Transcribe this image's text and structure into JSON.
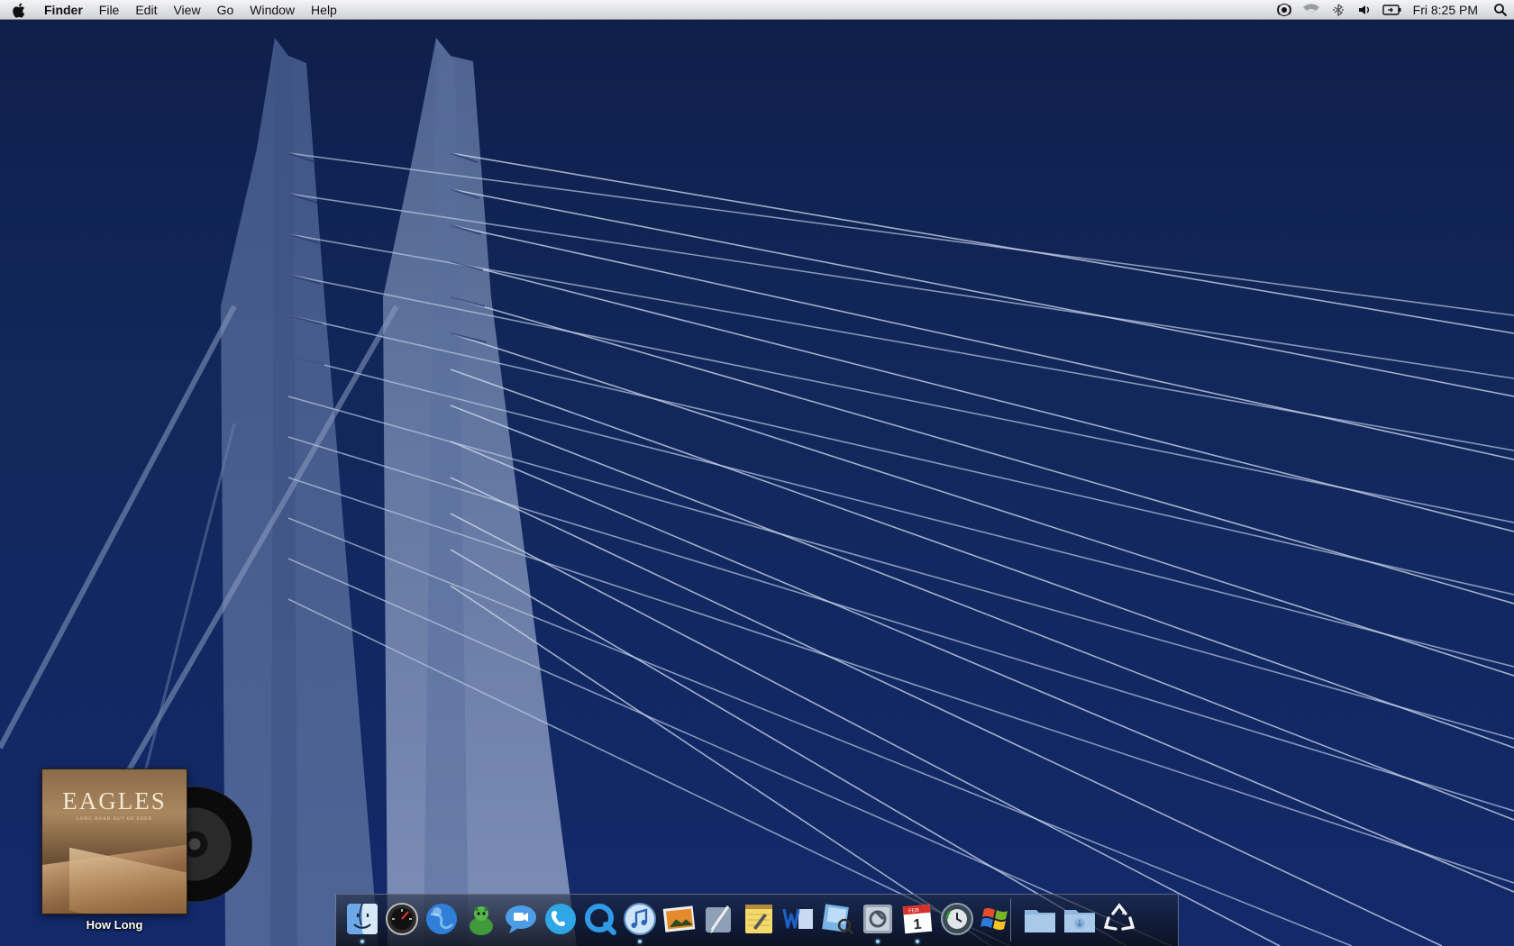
{
  "menubar": {
    "app_name": "Finder",
    "menus": [
      "File",
      "Edit",
      "View",
      "Go",
      "Window",
      "Help"
    ],
    "status_icons": [
      "radio-icon",
      "wifi-icon",
      "bluetooth-icon",
      "volume-icon",
      "battery-icon"
    ],
    "clock": "Fri 8:25 PM",
    "spotlight_icon": "spotlight-search-icon"
  },
  "desktop": {
    "wallpaper": "cable-stayed bridge pylons on dark blue",
    "background_color": "#12285c"
  },
  "album_widget": {
    "band_text": "EAGLES",
    "album_subtitle": "LONG ROAD OUT OF EDEN",
    "track_caption": "How Long"
  },
  "dock": {
    "apps": [
      {
        "icon": "finder-icon",
        "running": true
      },
      {
        "icon": "dashboard-icon",
        "running": false
      },
      {
        "icon": "safari-globe-icon",
        "running": false
      },
      {
        "icon": "adium-duck-icon",
        "running": false
      },
      {
        "icon": "ichat-icon",
        "running": false
      },
      {
        "icon": "skype-icon",
        "running": false
      },
      {
        "icon": "quicktime-icon",
        "running": false
      },
      {
        "icon": "itunes-icon",
        "running": true
      },
      {
        "icon": "iphoto-icon",
        "running": false
      },
      {
        "icon": "script-editor-icon",
        "running": false
      },
      {
        "icon": "notes-icon",
        "running": false
      },
      {
        "icon": "word-icon",
        "running": false
      },
      {
        "icon": "preview-icon",
        "running": false
      },
      {
        "icon": "system-preferences-icon",
        "running": true
      },
      {
        "icon": "ical-icon",
        "running": true
      },
      {
        "icon": "time-machine-icon",
        "running": false
      },
      {
        "icon": "windows-boot-camp-icon",
        "running": false
      }
    ],
    "stacks": [
      {
        "icon": "documents-folder-icon"
      },
      {
        "icon": "downloads-folder-icon"
      },
      {
        "icon": "trash-recycle-icon"
      }
    ],
    "ical_month": "FEB",
    "ical_day": "1",
    "accent": "#9fd0ff"
  }
}
